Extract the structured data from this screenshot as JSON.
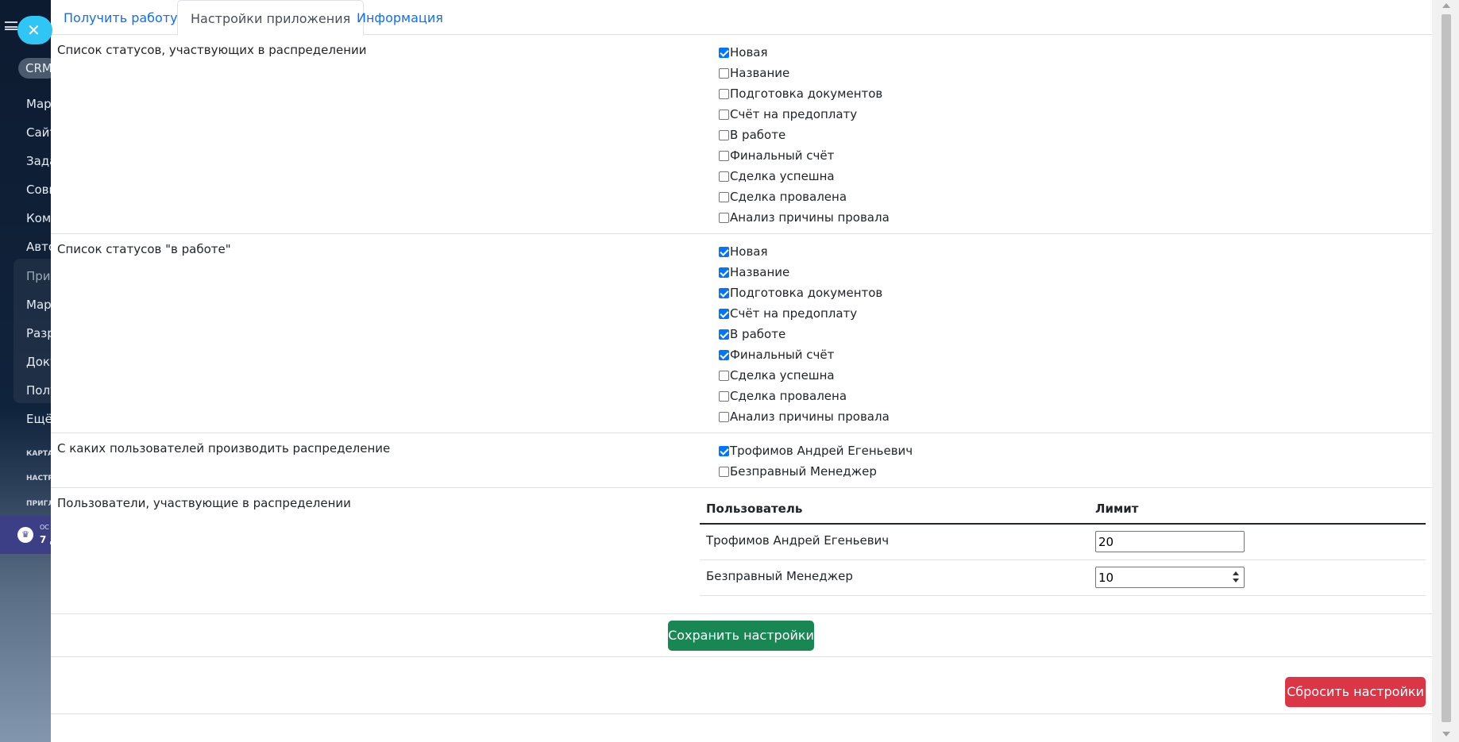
{
  "background_sidebar": {
    "crm": "CRM",
    "items": [
      {
        "label": "Мар",
        "style": ""
      },
      {
        "label": "Сайт",
        "style": ""
      },
      {
        "label": "Зада",
        "style": ""
      },
      {
        "label": "Совм",
        "style": ""
      },
      {
        "label": "Ком",
        "style": ""
      },
      {
        "label": "Авто",
        "style": ""
      },
      {
        "label": "Прил",
        "style": "dim"
      },
      {
        "label": "Мар",
        "style": ""
      },
      {
        "label": "Разр",
        "style": ""
      },
      {
        "label": "Доку",
        "style": ""
      },
      {
        "label": "Полу",
        "style": ""
      },
      {
        "label": "Ещё",
        "style": ""
      },
      {
        "label": "КАРТА",
        "style": "small"
      },
      {
        "label": "НАСТР",
        "style": "small"
      },
      {
        "label": "ПРИГЛ",
        "style": "small"
      }
    ],
    "promo_line1": "ОС",
    "promo_line2": "7 Д"
  },
  "tabs": [
    {
      "label": "Получить работу",
      "active": false
    },
    {
      "label": "Настройки приложения",
      "active": true
    },
    {
      "label": "Информация",
      "active": false
    }
  ],
  "sections": {
    "distribution_statuses": {
      "label": "Список статусов, участвующих в распределении",
      "options": [
        {
          "label": "Новая",
          "checked": true
        },
        {
          "label": "Название",
          "checked": false
        },
        {
          "label": "Подготовка документов",
          "checked": false
        },
        {
          "label": "Счёт на предоплату",
          "checked": false
        },
        {
          "label": "В работе",
          "checked": false
        },
        {
          "label": "Финальный счёт",
          "checked": false
        },
        {
          "label": "Сделка успешна",
          "checked": false
        },
        {
          "label": "Сделка провалена",
          "checked": false
        },
        {
          "label": "Анализ причины провала",
          "checked": false
        }
      ]
    },
    "in_work_statuses": {
      "label": "Список статусов \"в работе\"",
      "options": [
        {
          "label": "Новая",
          "checked": true
        },
        {
          "label": "Название",
          "checked": true
        },
        {
          "label": "Подготовка документов",
          "checked": true
        },
        {
          "label": "Счёт на предоплату",
          "checked": true
        },
        {
          "label": "В работе",
          "checked": true
        },
        {
          "label": "Финальный счёт",
          "checked": true
        },
        {
          "label": "Сделка успешна",
          "checked": false
        },
        {
          "label": "Сделка провалена",
          "checked": false
        },
        {
          "label": "Анализ причины провала",
          "checked": false
        }
      ]
    },
    "source_users": {
      "label": "С каких пользователей производить распределение",
      "options": [
        {
          "label": "Трофимов Андрей Егеньевич",
          "checked": true
        },
        {
          "label": "Безправный Менеджер",
          "checked": false
        }
      ]
    },
    "participants": {
      "label": "Пользователи, участвующие в распределении",
      "columns": [
        "Пользователь",
        "Лимит"
      ],
      "rows": [
        {
          "user": "Трофимов Андрей Егеньевич",
          "limit": "20"
        },
        {
          "user": "Безправный Менеджер",
          "limit": "10"
        }
      ]
    }
  },
  "buttons": {
    "save": "Сохранить настройки",
    "reset": "Сбросить настройки"
  },
  "colors": {
    "save": "#198754",
    "reset": "#dc3545",
    "link": "#0d6efd",
    "checkbox": "#0075ff"
  }
}
